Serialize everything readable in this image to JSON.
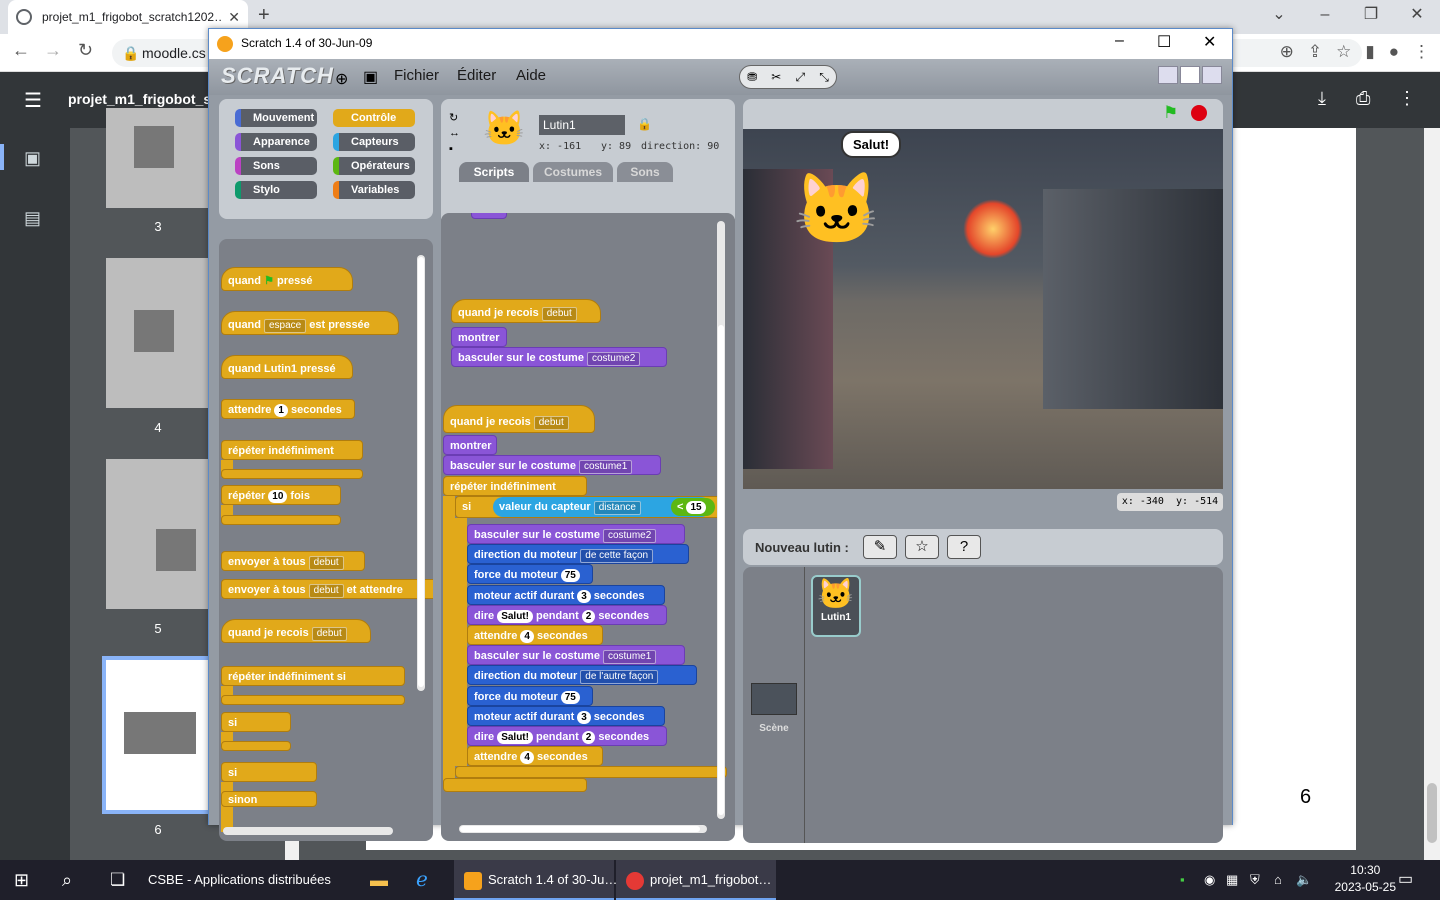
{
  "browser": {
    "tab_title": "projet_m1_frigobot_scratch1202…",
    "url": "moodle.cs",
    "pdf_title": "projet_m1_frigobot_sc"
  },
  "pdf": {
    "thumb_numbers": [
      "3",
      "4",
      "5",
      "6"
    ],
    "page_number": "6"
  },
  "scratch": {
    "window_title": "Scratch 1.4 of 30-Jun-09",
    "logo": "SCRATCH",
    "menu": [
      "Fichier",
      "Éditer",
      "Aide"
    ],
    "categories": [
      {
        "label": "Mouvement",
        "color": "#4a6cd4"
      },
      {
        "label": "Contrôle",
        "color": "#e1a91a"
      },
      {
        "label": "Apparence",
        "color": "#8a55d7"
      },
      {
        "label": "Capteurs",
        "color": "#2ca5e2"
      },
      {
        "label": "Sons",
        "color": "#bb42c3"
      },
      {
        "label": "Opérateurs",
        "color": "#5cb712"
      },
      {
        "label": "Stylo",
        "color": "#0e9a6c"
      },
      {
        "label": "Variables",
        "color": "#ee7d16"
      }
    ],
    "sprite": {
      "name": "Lutin1",
      "x": "x: -161",
      "y": "y: 89",
      "direction": "direction: 90"
    },
    "tabs": [
      "Scripts",
      "Costumes",
      "Sons"
    ],
    "palette": {
      "when_flag_1": "quand",
      "when_flag_2": "pressé",
      "when_key_1": "quand",
      "when_key_dd": "espace",
      "when_key_2": "est pressée",
      "when_sprite": "quand Lutin1 pressé",
      "wait_1": "attendre",
      "wait_val": "1",
      "wait_2": "secondes",
      "forever": "répéter indéfiniment",
      "repeat_1": "répéter",
      "repeat_val": "10",
      "repeat_2": "fois",
      "broadcast": "envoyer à tous",
      "broadcast_dd": "debut",
      "broadcast_wait": "envoyer à tous",
      "broadcast_wait_dd": "debut",
      "broadcast_wait_2": "et attendre",
      "when_receive": "quand je recois",
      "when_receive_dd": "debut",
      "forever_if": "répéter indéfiniment si",
      "if": "si",
      "if2": "si",
      "else": "sinon"
    },
    "script1": {
      "hat": "quand je recois",
      "hat_dd": "debut",
      "show": "montrer",
      "costume": "basculer sur le costume",
      "costume_dd": "costume2"
    },
    "script2": {
      "hat": "quand je recois",
      "hat_dd": "debut",
      "show": "montrer",
      "costume": "basculer sur le costume",
      "costume_dd": "costume1",
      "forever": "répéter indéfiniment",
      "if": "si",
      "sensor": "valeur du capteur",
      "sensor_dd": "distance",
      "lt": "<",
      "lt_val": "15",
      "rows": [
        {
          "cls": "lk",
          "t1": "basculer sur le costume",
          "dd": "costume2"
        },
        {
          "cls": "mo",
          "t1": "direction du moteur",
          "dd": "de cette façon"
        },
        {
          "cls": "mo",
          "t1": "force du moteur",
          "inp": "75"
        },
        {
          "cls": "mo",
          "t1": "moteur actif durant",
          "inp": "3",
          "t2": "secondes"
        },
        {
          "cls": "lk",
          "t1": "dire",
          "inp": "Salut!",
          "t2": "pendant",
          "inp2": "2",
          "t3": "secondes"
        },
        {
          "cls": "ctl",
          "t1": "attendre",
          "inp": "4",
          "t2": "secondes"
        },
        {
          "cls": "lk",
          "t1": "basculer sur le costume",
          "dd": "costume1"
        },
        {
          "cls": "mo",
          "t1": "direction du moteur",
          "dd": "de l'autre façon"
        },
        {
          "cls": "mo",
          "t1": "force du moteur",
          "inp": "75"
        },
        {
          "cls": "mo",
          "t1": "moteur actif durant",
          "inp": "3",
          "t2": "secondes"
        },
        {
          "cls": "lk",
          "t1": "dire",
          "inp": "Salut!",
          "t2": "pendant",
          "inp2": "2",
          "t3": "secondes"
        },
        {
          "cls": "ctl",
          "t1": "attendre",
          "inp": "4",
          "t2": "secondes"
        }
      ]
    },
    "stage": {
      "speech": "Salut!",
      "mouse_x": "x: -340",
      "mouse_y": "y: -514"
    },
    "new_sprite_label": "Nouveau lutin :",
    "sprite_thumb_label": "Lutin1",
    "scene_label": "Scène"
  },
  "taskbar": {
    "item1": "CSBE - Applications distribuées",
    "item2": "Scratch 1.4 of 30-Ju…",
    "item3": "projet_m1_frigobot…",
    "time": "10:30",
    "date": "2023-05-25"
  }
}
